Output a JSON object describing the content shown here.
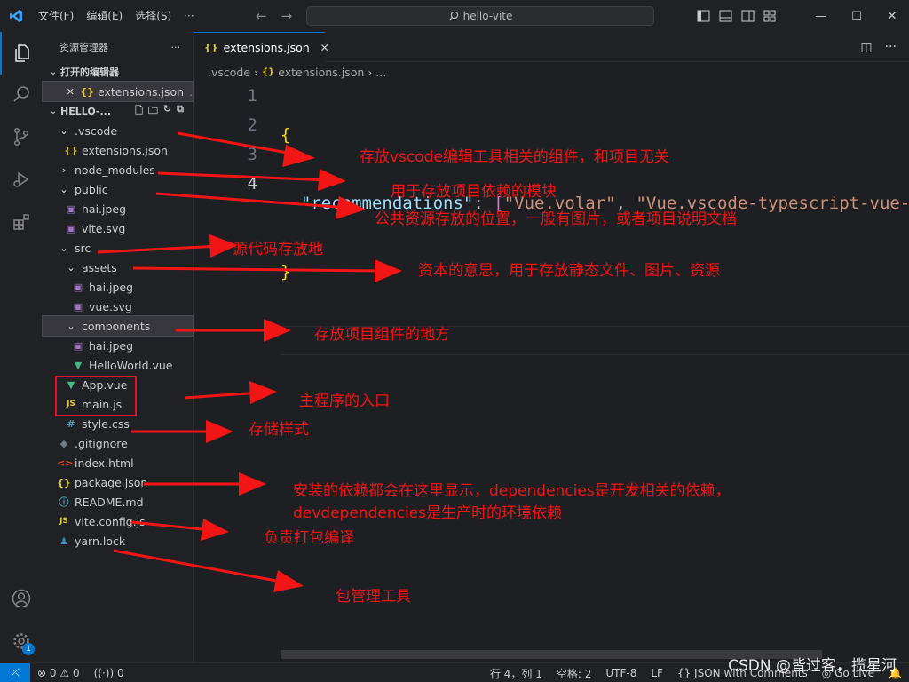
{
  "titlebar": {
    "menu": [
      "文件(F)",
      "编辑(E)",
      "选择(S)",
      "···"
    ],
    "search": "hello-vite",
    "window_controls": [
      "—",
      "☐",
      "✕"
    ]
  },
  "activity": {
    "account_badge": "1"
  },
  "sidebar": {
    "header": "资源管理器",
    "more": "···",
    "open_editors_title": "打开的编辑器",
    "open_editor_item": "extensions.json",
    "open_editor_path": ".",
    "project_title": "HELLO-...",
    "tree": [
      {
        "label": ".vscode",
        "icon": "folder-open",
        "indent": 1
      },
      {
        "label": "extensions.json",
        "icon": "json",
        "indent": 2
      },
      {
        "label": "node_modules",
        "icon": "folder-closed",
        "indent": 1
      },
      {
        "label": "public",
        "icon": "folder-open",
        "indent": 1
      },
      {
        "label": "hai.jpeg",
        "icon": "image",
        "indent": 2
      },
      {
        "label": "vite.svg",
        "icon": "image",
        "indent": 2
      },
      {
        "label": "src",
        "icon": "folder-open",
        "indent": 1
      },
      {
        "label": "assets",
        "icon": "folder-open",
        "indent": 2
      },
      {
        "label": "hai.jpeg",
        "icon": "image",
        "indent": 3
      },
      {
        "label": "vue.svg",
        "icon": "image",
        "indent": 3
      },
      {
        "label": "components",
        "icon": "folder-open",
        "indent": 2
      },
      {
        "label": "hai.jpeg",
        "icon": "image",
        "indent": 3
      },
      {
        "label": "HelloWorld.vue",
        "icon": "vue",
        "indent": 3
      },
      {
        "label": "App.vue",
        "icon": "vue",
        "indent": 2
      },
      {
        "label": "main.js",
        "icon": "js",
        "indent": 2
      },
      {
        "label": "style.css",
        "icon": "css",
        "indent": 2
      },
      {
        "label": ".gitignore",
        "icon": "git",
        "indent": 1
      },
      {
        "label": "index.html",
        "icon": "html",
        "indent": 1
      },
      {
        "label": "package.json",
        "icon": "json",
        "indent": 1
      },
      {
        "label": "README.md",
        "icon": "info",
        "indent": 1
      },
      {
        "label": "vite.config.js",
        "icon": "js",
        "indent": 1
      },
      {
        "label": "yarn.lock",
        "icon": "yarn",
        "indent": 1
      }
    ]
  },
  "editor": {
    "tab_label": "extensions.json",
    "breadcrumb": [
      ".vscode",
      "extensions.json",
      "..."
    ],
    "line_numbers": [
      "1",
      "2",
      "3",
      "4"
    ],
    "code": {
      "open_brace": "{",
      "key": "\"recommendations\"",
      "colon": ": ",
      "open_bracket": "[",
      "value1": "\"Vue.volar\"",
      "comma": ", ",
      "value2": "\"Vue.vscode-typescript-vue-plugin\"",
      "close_brace": "}"
    }
  },
  "statusbar": {
    "errors": "0",
    "warnings": "0",
    "ports": "0",
    "position": "行 4，列 1",
    "spaces": "空格: 2",
    "encoding": "UTF-8",
    "eol": "LF",
    "language": "JSON with Comments",
    "golive": "Go Live"
  },
  "watermark": "CSDN @皆过客，揽星河",
  "annotations": [
    "存放vscode编辑工具相关的组件，和项目无关",
    "用于存放项目依赖的模块",
    "公共资源存放的位置，一般有图片，或者项目说明文档",
    "源代码存放地",
    "资本的意思，用于存放静态文件、图片、资源",
    "存放项目组件的地方",
    "主程序的入口",
    "存储样式",
    "安装的依赖都会在这里显示，dependencies是开发相关的依赖，",
    "devdependencies是生产时的环境依赖",
    "负责打包编译",
    "包管理工具"
  ],
  "colors": {
    "accent": "#0078d4",
    "annotation": "#f21515",
    "background": "#1e1f22"
  }
}
